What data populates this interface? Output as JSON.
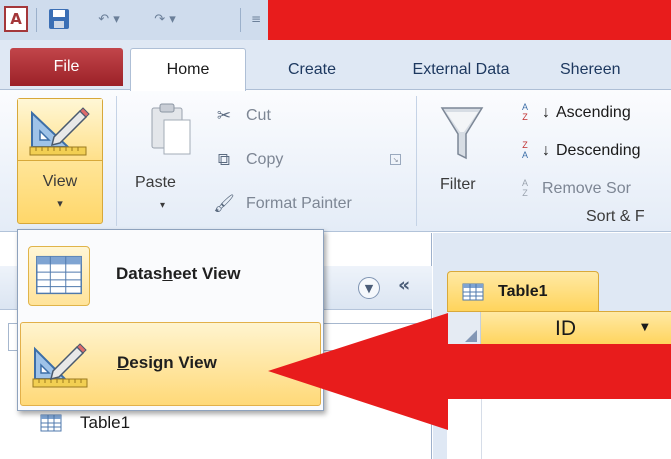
{
  "quick_access": {
    "app_icon_letter": "A"
  },
  "tabs": {
    "file": "File",
    "home": "Home",
    "create": "Create",
    "external_data": "External Data",
    "user": "Shereen"
  },
  "ribbon": {
    "view": {
      "label": "View",
      "arrow": "▾"
    },
    "clipboard": {
      "paste": "Paste",
      "paste_arrow": "▾",
      "cut": "Cut",
      "copy": "Copy",
      "format_painter": "Format Painter"
    },
    "sort_filter": {
      "filter": "Filter",
      "ascending": "Ascending",
      "descending": "Descending",
      "remove_sort": "Remove Sor",
      "group_label": "Sort & F"
    }
  },
  "view_menu": {
    "items": [
      {
        "prefix": "Datas",
        "underline": "h",
        "suffix": "eet View"
      },
      {
        "prefix": "",
        "underline": "D",
        "suffix": "esign View"
      }
    ]
  },
  "navigation_pane": {
    "collapse_glyph": "«",
    "items": [
      {
        "label": "Table1"
      }
    ]
  },
  "document": {
    "tab_label": "Table1",
    "columns": [
      {
        "header": "ID"
      }
    ]
  },
  "colors": {
    "annotation_arrow": "#e81c1c",
    "highlight": "#ffd76a",
    "file_tab": "#b1343a"
  }
}
